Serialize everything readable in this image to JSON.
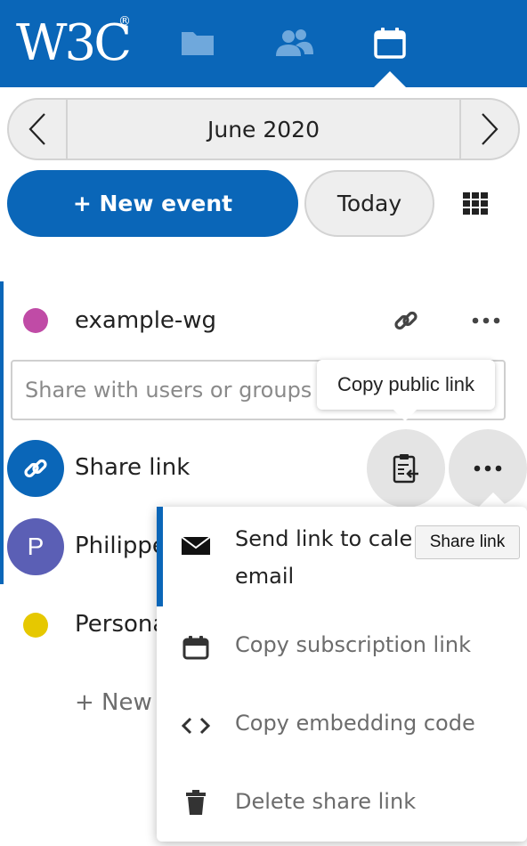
{
  "header": {
    "logo_text": "W3C",
    "logo_mark": "®",
    "nav": [
      {
        "icon": "folder-icon"
      },
      {
        "icon": "contacts-icon"
      },
      {
        "icon": "calendar-icon",
        "active": true
      }
    ],
    "bg_color": "#0a66b8"
  },
  "month_nav": {
    "label": "June 2020",
    "prev_icon": "chevron-left-icon",
    "next_icon": "chevron-right-icon"
  },
  "actions": {
    "new_event_label": "+ New event",
    "today_label": "Today",
    "view_icon": "grid-icon"
  },
  "calendars": [
    {
      "name": "example-wg",
      "color": "#c04ba6"
    },
    {
      "name": "Persona",
      "color": "#e6c800"
    }
  ],
  "sharing": {
    "search_placeholder": "Share with users or groups",
    "share_link_label": "Share link",
    "user_name": "Philippe",
    "user_initial": "P",
    "user_color": "#5b5fb5"
  },
  "new_calendar_label": "+ New",
  "tooltip_copy_public": "Copy public link",
  "tooltip_share_link": "Share link",
  "menu": {
    "items": [
      {
        "label": "Send link to calendar via email",
        "visible_label_line1": "Send link to cale",
        "visible_label_line2": "email",
        "icon": "mail-icon"
      },
      {
        "label": "Copy subscription link",
        "icon": "calendar-icon"
      },
      {
        "label": "Copy embedding code",
        "icon": "code-icon"
      },
      {
        "label": "Delete share link",
        "icon": "trash-icon"
      }
    ]
  }
}
